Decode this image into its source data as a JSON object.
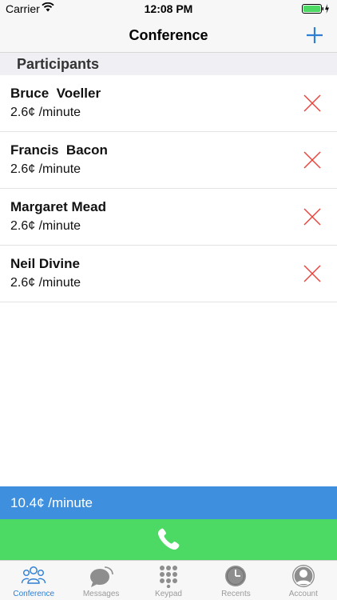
{
  "status_bar": {
    "carrier": "Carrier",
    "time": "12:08 PM"
  },
  "nav": {
    "title": "Conference",
    "add_icon": "plus-icon"
  },
  "section": {
    "title": "Participants"
  },
  "participants": [
    {
      "name": "Bruce  Voeller",
      "rate": "2.6¢ /minute"
    },
    {
      "name": "Francis  Bacon",
      "rate": "2.6¢ /minute"
    },
    {
      "name": "Margaret Mead",
      "rate": "2.6¢ /minute"
    },
    {
      "name": "Neil Divine",
      "rate": "2.6¢ /minute"
    }
  ],
  "total": {
    "rate": "10.4¢ /minute"
  },
  "call": {
    "icon": "phone-icon"
  },
  "tabs": [
    {
      "label": "Conference",
      "icon": "group-icon",
      "active": true
    },
    {
      "label": "Messages",
      "icon": "chat-icon",
      "active": false
    },
    {
      "label": "Keypad",
      "icon": "keypad-icon",
      "active": false
    },
    {
      "label": "Recents",
      "icon": "clock-icon",
      "active": false
    },
    {
      "label": "Account",
      "icon": "person-icon",
      "active": false
    }
  ],
  "colors": {
    "accent": "#2f7fd4",
    "remove": "#e8413a",
    "total_bar": "#3e8fde",
    "call_bar": "#4cd964"
  }
}
